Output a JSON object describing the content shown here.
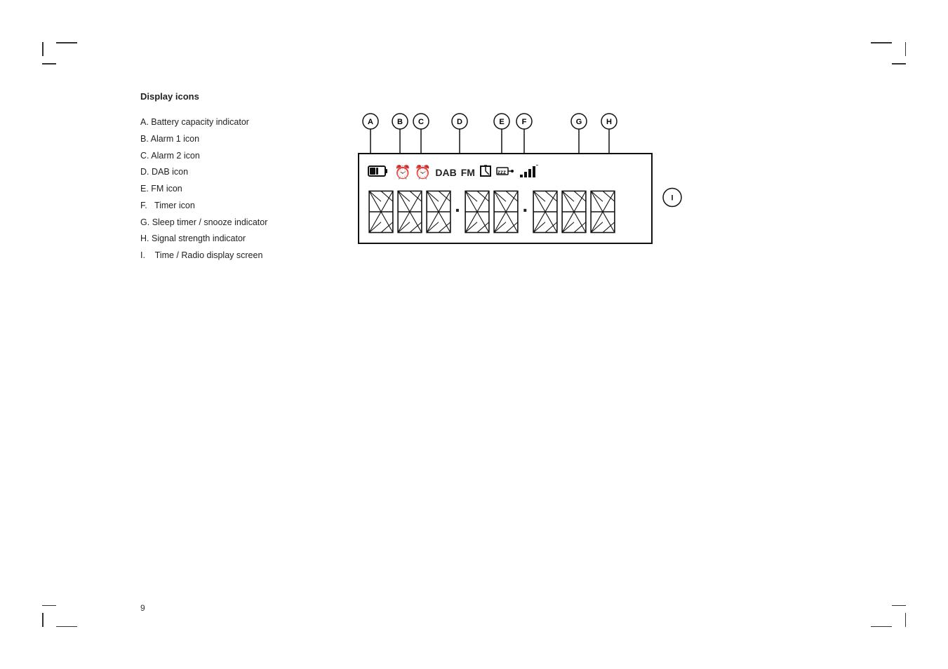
{
  "page": {
    "number": "9"
  },
  "section": {
    "title": "Display icons"
  },
  "items": [
    {
      "letter": "A",
      "label": "Battery capacity indicator"
    },
    {
      "letter": "B",
      "label": "Alarm 1 icon"
    },
    {
      "letter": "C",
      "label": "Alarm 2 icon"
    },
    {
      "letter": "D",
      "label": "DAB icon"
    },
    {
      "letter": "E",
      "label": "FM icon"
    },
    {
      "letter": "F",
      "label": "Timer icon"
    },
    {
      "letter": "G",
      "label": "Sleep timer / snooze indicator"
    },
    {
      "letter": "H",
      "label": "Signal strength indicator"
    },
    {
      "letter": "I",
      "label": "Time / Radio display screen"
    }
  ],
  "labels": {
    "A": "A",
    "B": "B",
    "C": "C",
    "D": "D",
    "E": "E",
    "F": "F",
    "G": "G",
    "H": "H",
    "I": "I"
  }
}
